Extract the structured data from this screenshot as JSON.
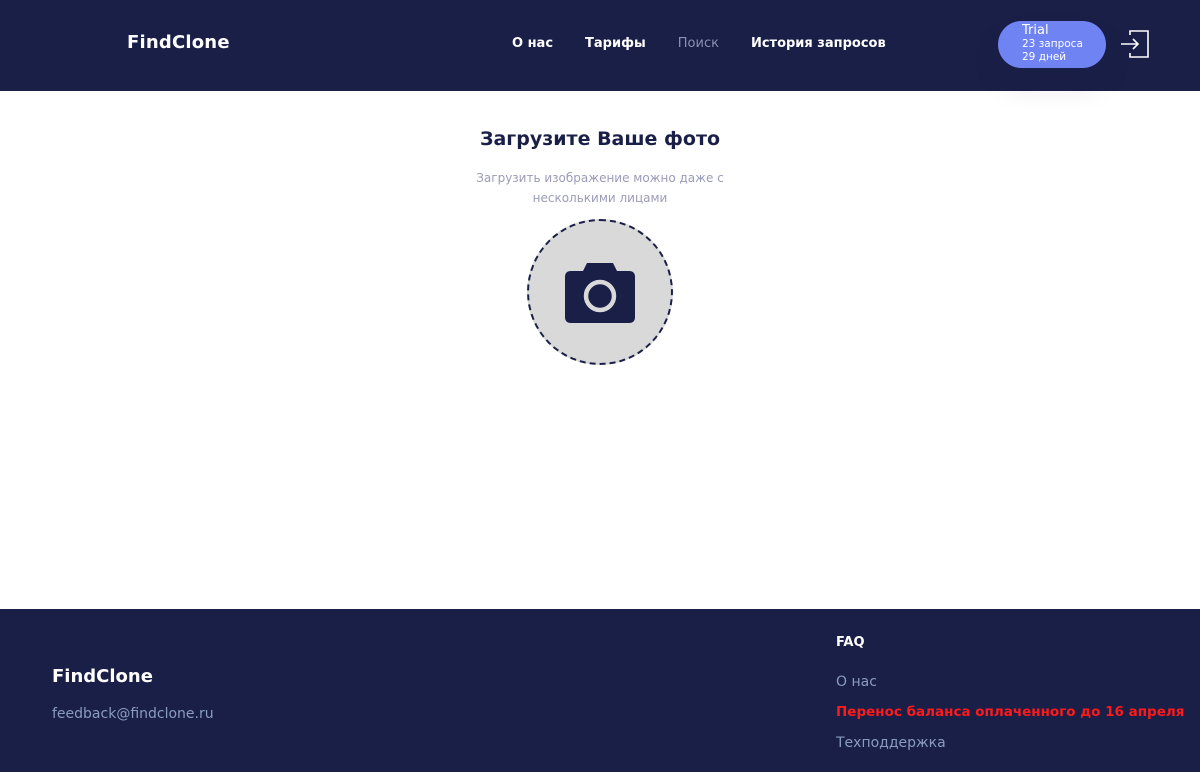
{
  "header": {
    "logo": "FindClone",
    "nav": [
      {
        "label": "О нас",
        "active": false
      },
      {
        "label": "Тарифы",
        "active": false
      },
      {
        "label": "Поиск",
        "active": true
      },
      {
        "label": "История запросов",
        "active": false
      }
    ],
    "trial": {
      "title": "Trial",
      "requests": "23 запроса",
      "days": "29 дней"
    },
    "login_icon": "login-icon"
  },
  "main": {
    "title": "Загрузите Ваше фото",
    "subtitle": "Загрузить изображение можно даже с несколькими лицами",
    "upload_icon": "camera-icon"
  },
  "footer": {
    "logo": "FindClone",
    "email": "feedback@findclone.ru",
    "faq": "FAQ",
    "links": {
      "about": "О нас",
      "transfer": "Перенос баланса оплаченного до 16 апреля",
      "support": "Техподдержка"
    }
  },
  "colors": {
    "navy": "#1a1f48",
    "accent": "#6f83f3",
    "muted": "#8a9bc2",
    "alert": "#ff1a1a",
    "circle_fill": "#d9d9d9"
  }
}
